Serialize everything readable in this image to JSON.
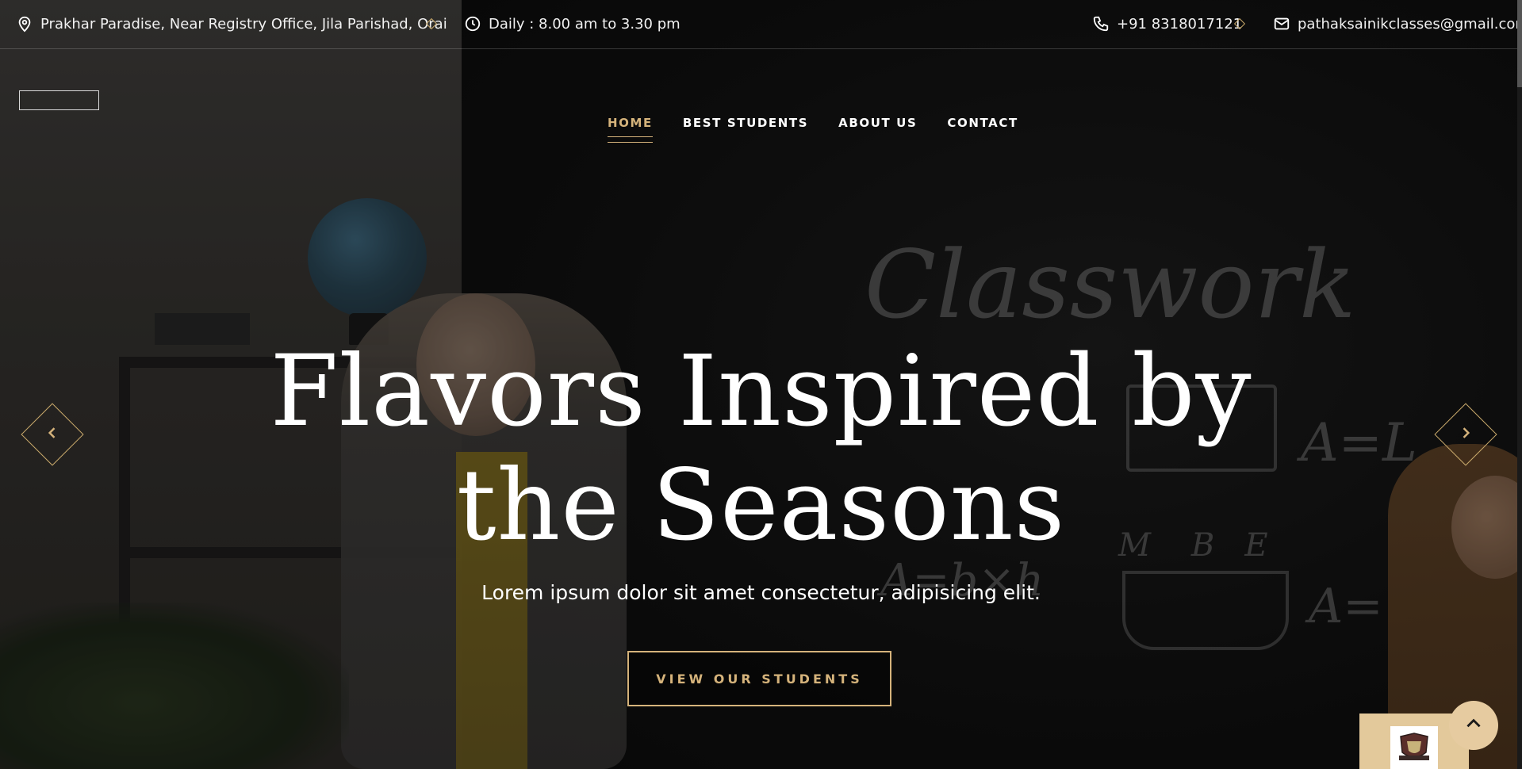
{
  "topbar": {
    "address": "Prakhar Paradise, Near Registry Office, Jila Parishad, Orai",
    "hours": "Daily : 8.00 am to 3.30 pm",
    "phone": "+91 8318017121",
    "email": "pathaksainikclasses@gmail.com"
  },
  "nav": {
    "items": [
      {
        "label": "HOME",
        "active": true
      },
      {
        "label": "BEST STUDENTS",
        "active": false
      },
      {
        "label": "ABOUT US",
        "active": false
      },
      {
        "label": "CONTACT",
        "active": false
      }
    ]
  },
  "hero": {
    "headline_line1": "Flavors Inspired by",
    "headline_line2": "the Seasons",
    "subtitle": "Lorem ipsum dolor sit amet consectetur, adipisicing elit.",
    "cta_label": "VIEW OUR STUDENTS"
  },
  "background_chalk": {
    "word": "Classwork"
  },
  "colors": {
    "accent": "#d5b37b",
    "badge": "#e3c99b"
  },
  "icons": {
    "address": "map-pin-icon",
    "hours": "clock-icon",
    "phone": "phone-icon",
    "email": "mail-icon",
    "prev": "chevron-left-icon",
    "next": "chevron-right-icon",
    "to_top": "chevron-up-icon"
  }
}
